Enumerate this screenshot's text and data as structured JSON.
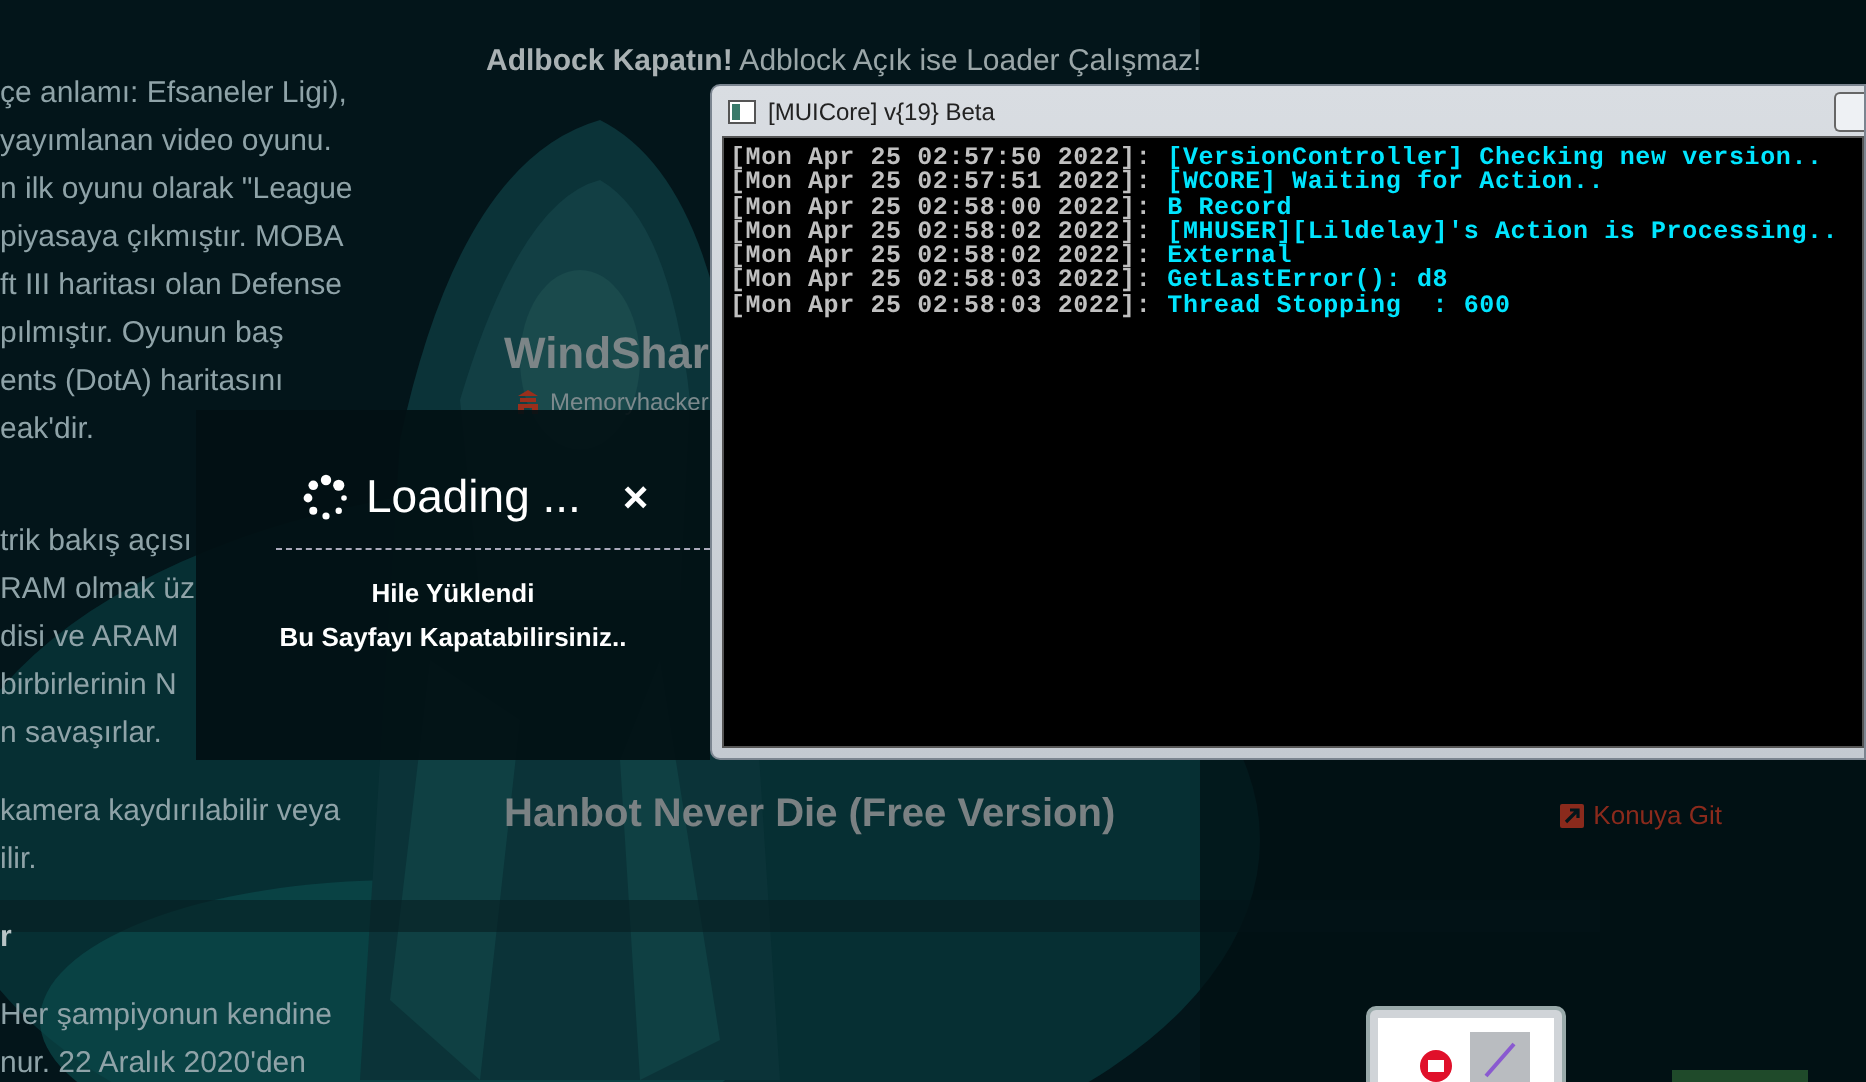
{
  "page": {
    "notice": {
      "emphasis": "Adlbock Kapatın!",
      "text": "Adblock Açık ise Loader Çalışmaz!"
    },
    "article": [
      {
        "kind": "text",
        "lines": [
          "çe anlamı: Efsaneler Ligi),",
          "yayımlanan video oyunu.",
          "n ilk oyunu olarak \"League",
          "piyasaya çıkmıştır. MOBA",
          "ft III haritası olan Defense",
          "pılmıştır. Oyunun baş",
          "ents (DotA) haritasını",
          "eak'dir."
        ]
      },
      {
        "kind": "text",
        "lines": [
          "trik bakış açısı",
          "RAM olmak üz",
          "disi ve ARAM",
          "birbirlerinin N",
          "n savaşırlar."
        ]
      },
      {
        "kind": "text",
        "lines": [
          "kamera kaydırılabilir veya",
          "ilir."
        ]
      },
      {
        "kind": "heading",
        "lines": [
          "r"
        ]
      },
      {
        "kind": "text",
        "lines": [
          "Her şampiyonun kendine",
          "nur. 22 Aralık 2020'den"
        ]
      }
    ],
    "topics": [
      {
        "title": "WindShar",
        "author": "Memoryhacker"
      },
      {
        "title": "Hanbot Never Die (Free Version)",
        "link": "Konuya Git"
      }
    ]
  },
  "loading_dialog": {
    "title": "Loading ...",
    "close": "×",
    "messages": [
      "Hile Yüklendi",
      "Bu Sayfayı Kapatabilirsiniz.."
    ]
  },
  "console_window": {
    "title": "[MUICore] v{19} Beta",
    "lines": [
      {
        "time": "[Mon Apr 25 02:57:50 2022]:",
        "message": "[VersionController] Checking new version.."
      },
      {
        "time": "[Mon Apr 25 02:57:51 2022]:",
        "message": "[WCORE] Waiting for Action.."
      },
      {
        "time": "[Mon Apr 25 02:58:00 2022]:",
        "message": "B Record"
      },
      {
        "time": "[Mon Apr 25 02:58:02 2022]:",
        "message": "[MHUSER][Lildelay]'s Action is Processing.."
      },
      {
        "time": "[Mon Apr 25 02:58:02 2022]:",
        "message": "External"
      },
      {
        "time": "[Mon Apr 25 02:58:03 2022]:",
        "message": "GetLastError(): d8"
      },
      {
        "time": "[Mon Apr 25 02:58:03 2022]:",
        "message": "Thread Stopping  : 600"
      }
    ]
  }
}
